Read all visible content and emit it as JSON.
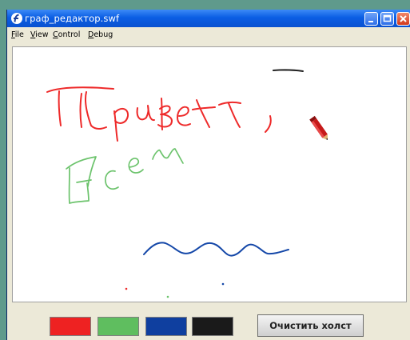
{
  "window": {
    "title": "граф_редактор.swf"
  },
  "menu": [
    {
      "label": "File"
    },
    {
      "label": "View"
    },
    {
      "label": "Control"
    },
    {
      "label": "Debug"
    }
  ],
  "palette": [
    {
      "name": "red",
      "color": "#ee2222"
    },
    {
      "name": "green",
      "color": "#5fbe5f"
    },
    {
      "name": "blue",
      "color": "#0f3f9f"
    },
    {
      "name": "black",
      "color": "#1a1a1a"
    }
  ],
  "clear_button": {
    "label": "Очистить холст"
  },
  "icons": {
    "app": "flash-player-icon",
    "pencil": "pencil-icon",
    "minimize": "minimize-icon",
    "maximize": "maximize-icon",
    "close": "close-icon"
  }
}
